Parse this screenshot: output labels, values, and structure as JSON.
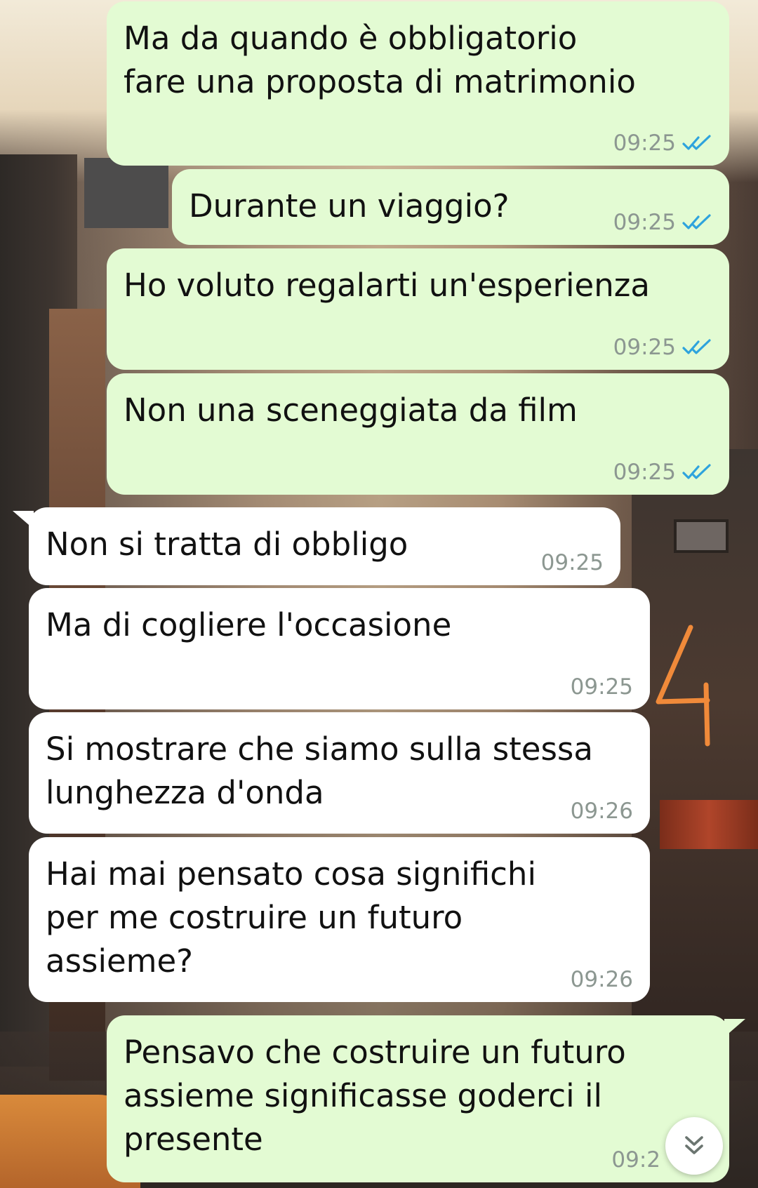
{
  "messages": [
    {
      "direction": "out",
      "text": "Ma da quando è obbligatorio\nfare una proposta di matrimonio",
      "time": "09:25",
      "status": "read"
    },
    {
      "direction": "out",
      "text": "Durante un viaggio?",
      "time": "09:25",
      "status": "read"
    },
    {
      "direction": "out",
      "text": "Ho voluto regalarti un'esperienza",
      "time": "09:25",
      "status": "read"
    },
    {
      "direction": "out",
      "text": "Non una sceneggiata da film",
      "time": "09:25",
      "status": "read"
    },
    {
      "direction": "in",
      "text": "Non si tratta di obbligo",
      "time": "09:25"
    },
    {
      "direction": "in",
      "text": "Ma di cogliere l'occasione",
      "time": "09:25"
    },
    {
      "direction": "in",
      "text": "Si mostrare che siamo sulla stessa\nlunghezza d'onda",
      "time": "09:26"
    },
    {
      "direction": "in",
      "text": "Hai mai pensato cosa significhi\nper me costruire un futuro\nassieme?",
      "time": "09:26"
    },
    {
      "direction": "out",
      "text": "Pensavo che costruire un futuro\nassieme significasse goderci il\npresente",
      "time": "09:2",
      "status": "read"
    }
  ],
  "annotation": {
    "text": "4",
    "color": "#f08a3a"
  },
  "colors": {
    "outgoing_bubble": "#e3fbd3",
    "incoming_bubble": "#ffffff",
    "read_ticks": "#2ea3dd",
    "timestamp": "#8c9791"
  },
  "icons": {
    "read_status": "double-check-icon",
    "scroll_down": "double-chevron-down-icon"
  }
}
